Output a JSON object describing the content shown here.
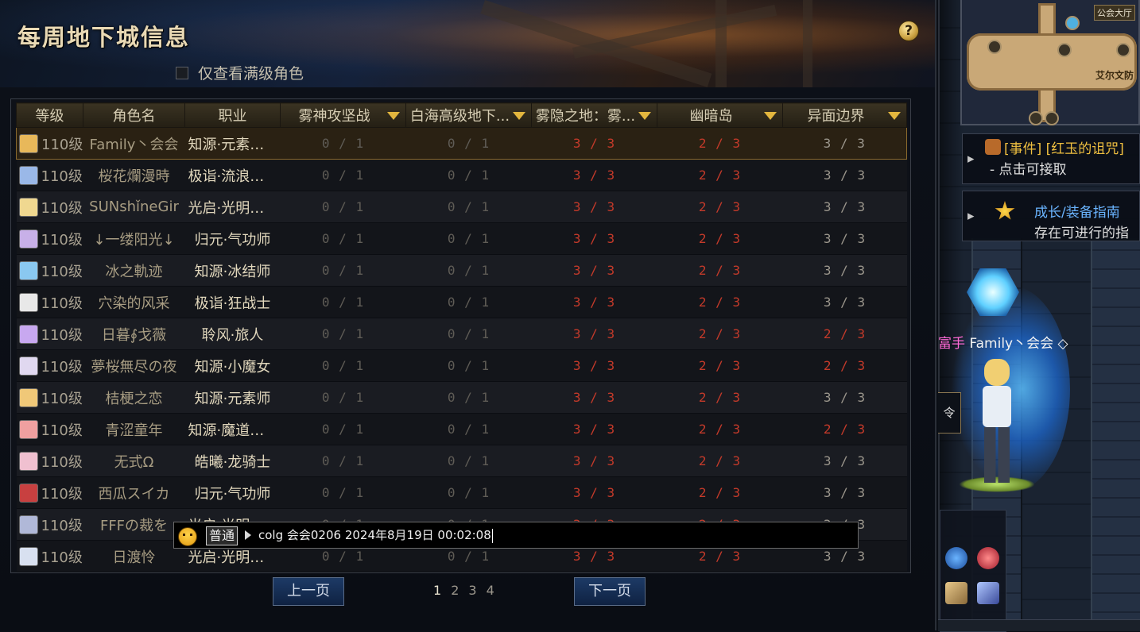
{
  "window": {
    "title": "每周地下城信息",
    "help_label": "?",
    "filter_label": "仅查看满级角色"
  },
  "table": {
    "columns": [
      {
        "label": "等级"
      },
      {
        "label": "角色名"
      },
      {
        "label": "职业"
      },
      {
        "label": "雾神攻坚战"
      },
      {
        "label": "白海高级地下..."
      },
      {
        "label": "雾隐之地：雾..."
      },
      {
        "label": "幽暗岛"
      },
      {
        "label": "异面边界"
      }
    ],
    "rows": [
      {
        "level": "110级",
        "name": "Family丶会会",
        "job": "知源·元素爆...",
        "c1": "0 / 1",
        "c2": "0 / 1",
        "c3": "3 / 3",
        "c4": "2 / 3",
        "c5": "3 / 3",
        "c5_red": false
      },
      {
        "level": "110级",
        "name": "桜花爛漫時",
        "job": "极诣·流浪武...",
        "c1": "0 / 1",
        "c2": "0 / 1",
        "c3": "3 / 3",
        "c4": "2 / 3",
        "c5": "3 / 3",
        "c5_red": false
      },
      {
        "level": "110级",
        "name": "SUNshǐneGir",
        "job": "光启·光明骑...",
        "c1": "0 / 1",
        "c2": "0 / 1",
        "c3": "3 / 3",
        "c4": "2 / 3",
        "c5": "3 / 3",
        "c5_red": false
      },
      {
        "level": "110级",
        "name": "↓一缕阳光↓",
        "job": "归元·气功师",
        "c1": "0 / 1",
        "c2": "0 / 1",
        "c3": "3 / 3",
        "c4": "2 / 3",
        "c5": "3 / 3",
        "c5_red": false
      },
      {
        "level": "110级",
        "name": "冰之軌迹",
        "job": "知源·冰结师",
        "c1": "0 / 1",
        "c2": "0 / 1",
        "c3": "3 / 3",
        "c4": "2 / 3",
        "c5": "3 / 3",
        "c5_red": false
      },
      {
        "level": "110级",
        "name": "穴染的风采",
        "job": "极诣·狂战士",
        "c1": "0 / 1",
        "c2": "0 / 1",
        "c3": "3 / 3",
        "c4": "2 / 3",
        "c5": "3 / 3",
        "c5_red": false
      },
      {
        "level": "110级",
        "name": "日暮∮戈薇",
        "job": "聆风·旅人",
        "c1": "0 / 1",
        "c2": "0 / 1",
        "c3": "3 / 3",
        "c4": "2 / 3",
        "c5": "2 / 3",
        "c5_red": true
      },
      {
        "level": "110级",
        "name": "夢桜無尽の夜",
        "job": "知源·小魔女",
        "c1": "0 / 1",
        "c2": "0 / 1",
        "c3": "3 / 3",
        "c4": "2 / 3",
        "c5": "2 / 3",
        "c5_red": true
      },
      {
        "level": "110级",
        "name": "桔梗之恋",
        "job": "知源·元素师",
        "c1": "0 / 1",
        "c2": "0 / 1",
        "c3": "3 / 3",
        "c4": "2 / 3",
        "c5": "3 / 3",
        "c5_red": false
      },
      {
        "level": "110级",
        "name": "青涩童年",
        "job": "知源·魔道学...",
        "c1": "0 / 1",
        "c2": "0 / 1",
        "c3": "3 / 3",
        "c4": "2 / 3",
        "c5": "2 / 3",
        "c5_red": true
      },
      {
        "level": "110级",
        "name": "无式Ω",
        "job": "皓曦·龙骑士",
        "c1": "0 / 1",
        "c2": "0 / 1",
        "c3": "3 / 3",
        "c4": "2 / 3",
        "c5": "3 / 3",
        "c5_red": false
      },
      {
        "level": "110级",
        "name": "西瓜スイカ",
        "job": "归元·气功师",
        "c1": "0 / 1",
        "c2": "0 / 1",
        "c3": "3 / 3",
        "c4": "2 / 3",
        "c5": "3 / 3",
        "c5_red": false
      },
      {
        "level": "110级",
        "name": "FFFの裁を",
        "job": "光启·光明骑...",
        "c1": "0 / 1",
        "c2": "0 / 1",
        "c3": "3 / 3",
        "c4": "2 / 3",
        "c5": "3 / 3",
        "c5_red": false
      },
      {
        "level": "110级",
        "name": "日渡怜",
        "job": "光启·光明骑...",
        "c1": "0 / 1",
        "c2": "0 / 1",
        "c3": "3 / 3",
        "c4": "2 / 3",
        "c5": "3 / 3",
        "c5_red": false
      }
    ]
  },
  "pagination": {
    "prev_label": "上一页",
    "next_label": "下一页",
    "pages": [
      "1",
      "2",
      "3",
      "4"
    ],
    "current_page": "1"
  },
  "chat": {
    "channel": "普通",
    "message": "colg 会会0206 2024年8月19日 00:02:08"
  },
  "scene": {
    "minimap_location_top": "公会大厅",
    "minimap_location_label": "艾尔文防",
    "quest1_line1": "[事件] [红玉的诅咒]",
    "quest1_line2": "- 点击可接取",
    "quest2_line1": "成长/装备指南",
    "quest2_line2": "存在可进行的指",
    "player_prefix": "富手",
    "player_name": "Family丶会会",
    "command_label": "令"
  },
  "colors": {
    "title": "#e9d9b4",
    "header_bg": "#3a3322",
    "cell_gray": "#5f5c56",
    "cell_red": "#c43a2a",
    "selected_border": "#8a6a2e",
    "quest_event": "#f0c040",
    "quest_guide": "#6ab4ff",
    "pager_bg": "#1d3a66"
  }
}
